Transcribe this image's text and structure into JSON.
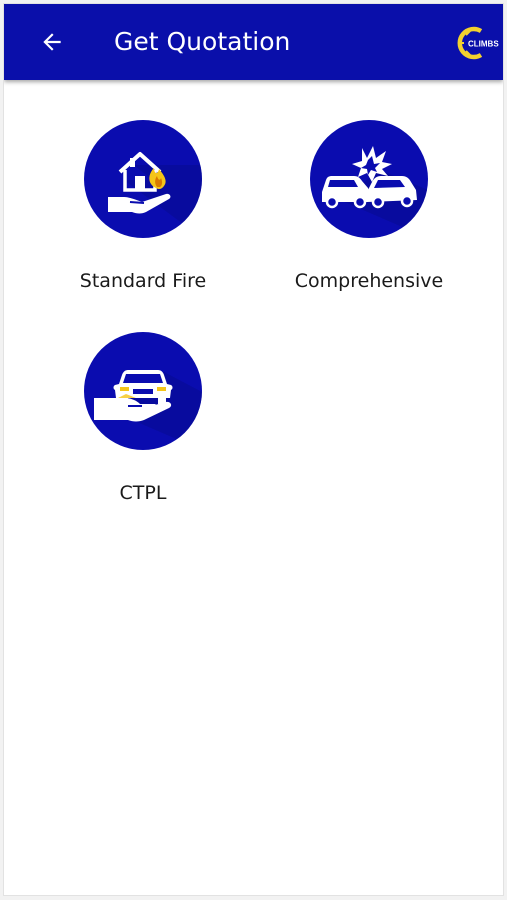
{
  "colors": {
    "app_bar": "#0a0faa",
    "icon_circle": "#0a0caf",
    "logo_accent": "#f2d12e",
    "label_text": "#1a1a1a"
  },
  "header": {
    "back_icon": "arrow-left-icon",
    "title": "Get Quotation",
    "logo_icon": "climbs-logo-icon",
    "logo_text": "CLIMBS"
  },
  "products": [
    {
      "label": "Standard Fire",
      "icon": "house-fire-hand-icon"
    },
    {
      "label": "Comprehensive",
      "icon": "car-collision-icon"
    },
    {
      "label": "CTPL",
      "icon": "car-hand-icon"
    }
  ]
}
